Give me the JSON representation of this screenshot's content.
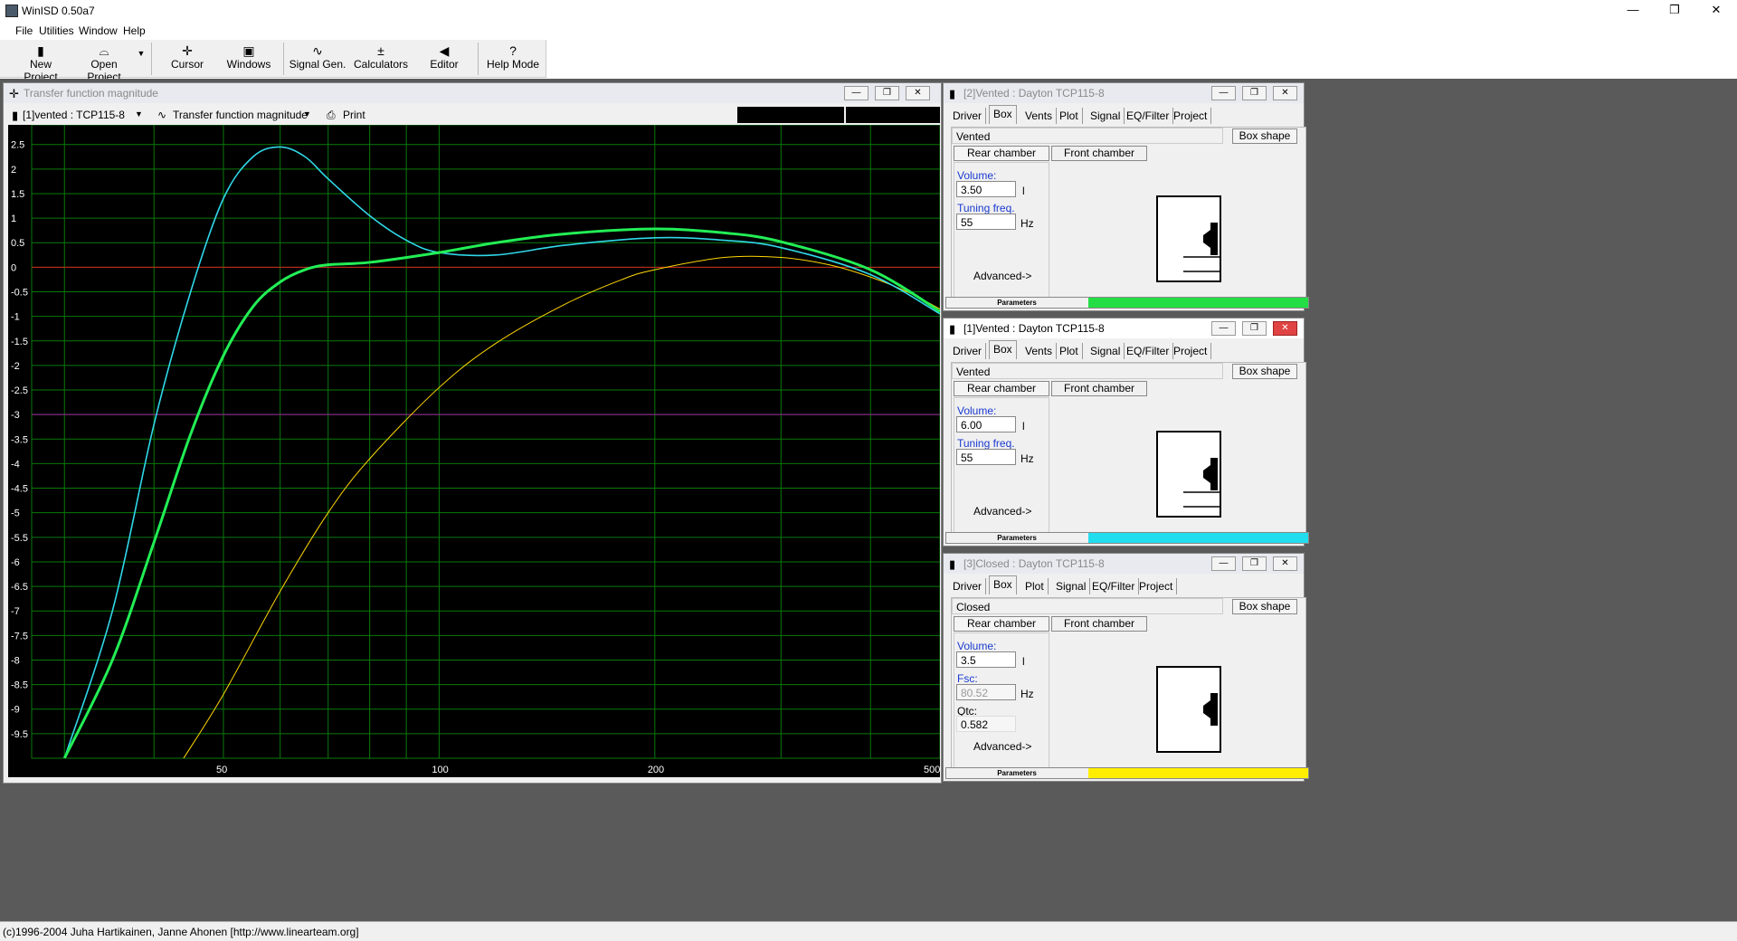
{
  "app": {
    "title": "WinISD 0.50a7"
  },
  "window_controls": {
    "minimize": "—",
    "restore": "❐",
    "close": "✕"
  },
  "menu": [
    "File",
    "Utilities",
    "Window",
    "Help"
  ],
  "toolbar": [
    {
      "label": "New Project",
      "icon": "new-project-icon"
    },
    {
      "label": "Open Project",
      "icon": "open-folder-icon"
    },
    {
      "label": "Cursor",
      "icon": "cursor-icon"
    },
    {
      "label": "Windows",
      "icon": "windows-icon"
    },
    {
      "label": "Signal Gen.",
      "icon": "sine-wave-icon"
    },
    {
      "label": "Calculators",
      "icon": "calculator-icon"
    },
    {
      "label": "Editor",
      "icon": "speaker-icon"
    },
    {
      "label": "Help Mode",
      "icon": "help-icon"
    }
  ],
  "graph_window": {
    "title": "Transfer function magnitude",
    "project_select": "[1]vented : TCP115-8",
    "graph_type": "Transfer function magnitude",
    "print_label": "Print"
  },
  "chart_data": {
    "type": "line",
    "x_scale": "log",
    "xlim": [
      27,
      500
    ],
    "ylim": [
      -10,
      2.9
    ],
    "x_tick_labels": [
      "50",
      "100",
      "200",
      "500"
    ],
    "x_ticks": [
      50,
      100,
      200,
      500
    ],
    "y_tick_labels": [
      "2.5",
      "2",
      "1.5",
      "1",
      "0.5",
      "0",
      "-0.5",
      "-1",
      "-1.5",
      "-2",
      "-2.5",
      "-3",
      "-3.5",
      "-4",
      "-4.5",
      "-5",
      "-5.5",
      "-6",
      "-6.5",
      "-7",
      "-7.5",
      "-8",
      "-8.5",
      "-9",
      "-9.5"
    ],
    "reference_lines": [
      {
        "y": 0,
        "color": "#d42020"
      },
      {
        "y": -3,
        "color": "#a020a0"
      }
    ],
    "grid": true,
    "grid_color": "#0a7a0a",
    "background": "#000000",
    "series": [
      {
        "color": "#ffd700",
        "width": 1,
        "x": [
          44,
          50,
          60,
          70,
          80,
          100,
          120,
          150,
          180,
          200,
          250,
          300,
          350,
          400,
          450,
          500
        ],
        "y": [
          -10,
          -8.7,
          -6.6,
          -5.0,
          -3.9,
          -2.45,
          -1.55,
          -0.75,
          -0.25,
          -0.05,
          0.2,
          0.2,
          0.05,
          -0.2,
          -0.5,
          -0.85
        ]
      },
      {
        "color": "#30d8e8",
        "width": 1.6,
        "x": [
          30,
          35,
          40,
          45,
          50,
          55,
          60,
          65,
          70,
          80,
          90,
          100,
          120,
          150,
          200,
          250,
          300,
          400,
          500
        ],
        "y": [
          -10,
          -7.0,
          -3.2,
          -0.5,
          1.4,
          2.25,
          2.45,
          2.25,
          1.8,
          1.05,
          0.55,
          0.3,
          0.25,
          0.45,
          0.6,
          0.55,
          0.4,
          -0.15,
          -0.95
        ]
      },
      {
        "color": "#22ee55",
        "width": 3,
        "x": [
          30,
          35,
          40,
          45,
          50,
          55,
          60,
          65,
          70,
          80,
          100,
          120,
          150,
          200,
          250,
          300,
          400,
          500
        ],
        "y": [
          -10,
          -8.0,
          -5.6,
          -3.4,
          -1.8,
          -0.8,
          -0.3,
          -0.05,
          0.05,
          0.1,
          0.3,
          0.5,
          0.68,
          0.78,
          0.7,
          0.52,
          -0.05,
          -0.9
        ]
      }
    ]
  },
  "panels": [
    {
      "title": "[2]Vented : Dayton TCP115-8",
      "active": false,
      "tabs": [
        "Driver",
        "Box",
        "Vents",
        "Plot",
        "Signal",
        "EQ/Filter",
        "Project"
      ],
      "box_type": "Vented",
      "box_shape": "Box shape",
      "rear": "Rear chamber",
      "front": "Front chamber",
      "fields": [
        {
          "label": "Volume:",
          "value": "3.50",
          "unit": "l"
        },
        {
          "label": "Tuning freq.",
          "value": "55",
          "unit": "Hz"
        }
      ],
      "advanced": "Advanced->",
      "params": "Parameters",
      "color": "#22dd44"
    },
    {
      "title": "[1]Vented : Dayton TCP115-8",
      "active": true,
      "tabs": [
        "Driver",
        "Box",
        "Vents",
        "Plot",
        "Signal",
        "EQ/Filter",
        "Project"
      ],
      "box_type": "Vented",
      "box_shape": "Box shape",
      "rear": "Rear chamber",
      "front": "Front chamber",
      "fields": [
        {
          "label": "Volume:",
          "value": "6.00",
          "unit": "l"
        },
        {
          "label": "Tuning freq.",
          "value": "55",
          "unit": "Hz"
        }
      ],
      "advanced": "Advanced->",
      "params": "Parameters",
      "color": "#22ddee"
    },
    {
      "title": "[3]Closed : Dayton TCP115-8",
      "active": false,
      "tabs": [
        "Driver",
        "Box",
        "Plot",
        "Signal",
        "EQ/Filter",
        "Project"
      ],
      "box_type": "Closed",
      "box_shape": "Box shape",
      "rear": "Rear chamber",
      "front": "Front chamber",
      "fields": [
        {
          "label": "Volume:",
          "value": "3.5",
          "unit": "l"
        },
        {
          "label": "Fsc:",
          "value": "80.52",
          "unit": "Hz",
          "disabled": true
        }
      ],
      "qtc_label": "Qtc:",
      "qtc_value": "0.582",
      "advanced": "Advanced->",
      "params": "Parameters",
      "color": "#ffee00"
    }
  ],
  "status": "(c)1996-2004 Juha Hartikainen, Janne Ahonen [http://www.linearteam.org]"
}
